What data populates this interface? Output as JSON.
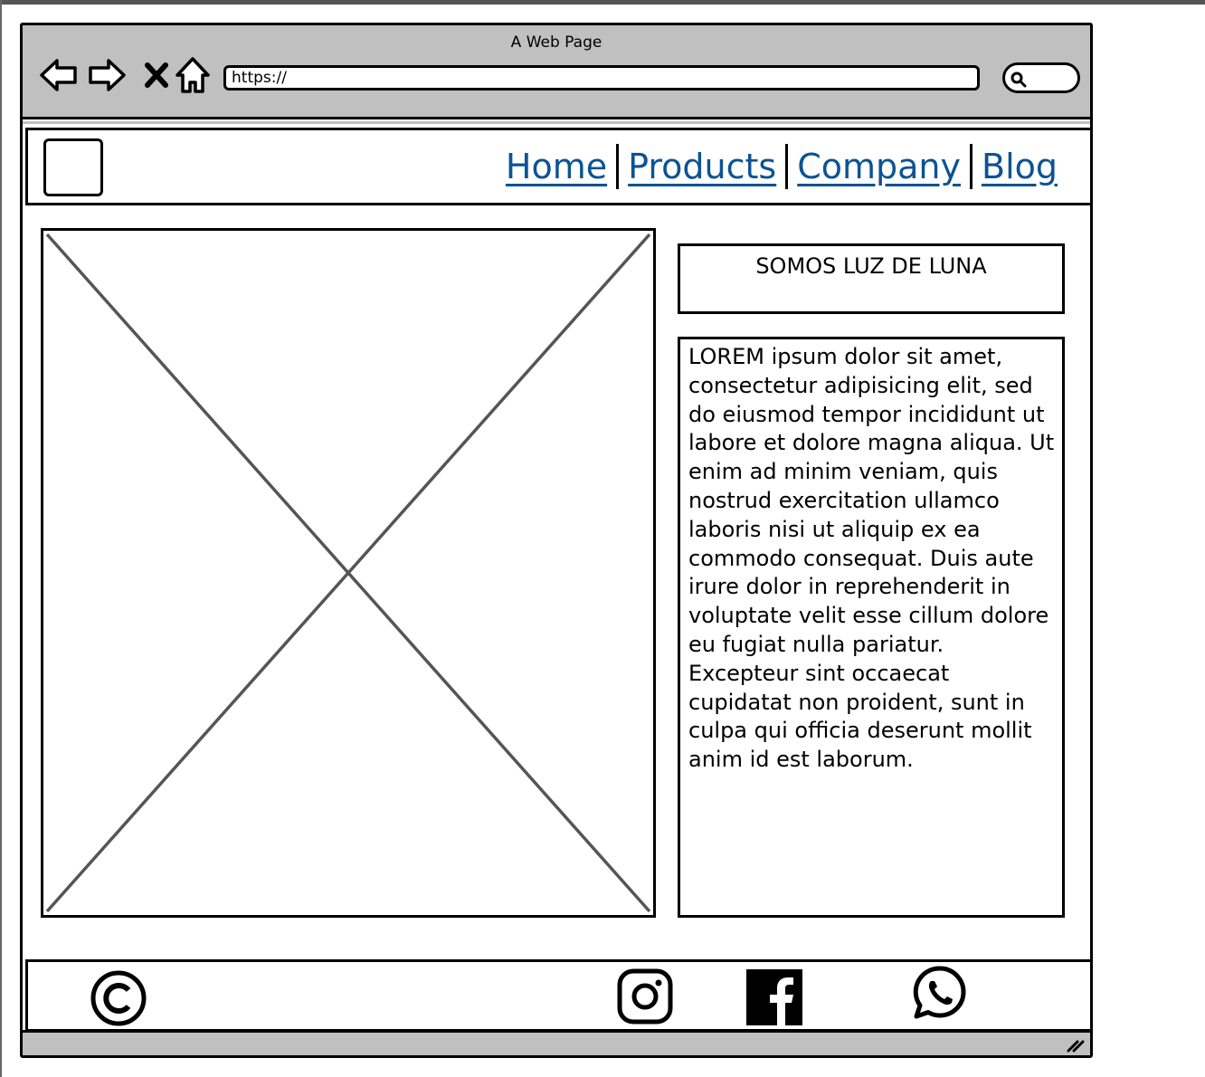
{
  "browser": {
    "title": "A Web Page",
    "url": "https://",
    "nav_icons": [
      "back-arrow-icon",
      "forward-arrow-icon",
      "close-icon",
      "home-icon"
    ],
    "search_icon": "search-icon"
  },
  "header": {
    "menu": [
      {
        "label": "Home"
      },
      {
        "label": "Products"
      },
      {
        "label": "Company"
      },
      {
        "label": "Blog"
      }
    ],
    "link_color": "#0b5394"
  },
  "main": {
    "heading": "SOMOS LUZ DE LUNA",
    "body": "LOREM ipsum dolor sit amet, consectetur adipisicing elit, sed do eiusmod tempor incididunt ut labore et dolore magna aliqua. Ut enim ad minim veniam, quis nostrud exercitation ullamco laboris nisi ut aliquip ex ea commodo consequat. Duis aute irure dolor in reprehenderit in voluptate velit esse cillum dolore eu fugiat nulla pariatur. Excepteur sint occaecat cupidatat non proident, sunt in culpa qui officia deserunt mollit anim id est laborum."
  },
  "footer": {
    "icons": [
      "copyright-icon",
      "instagram-icon",
      "facebook-icon",
      "whatsapp-icon"
    ]
  },
  "colors": {
    "chrome": "#c0c0c0",
    "border": "#000000"
  }
}
